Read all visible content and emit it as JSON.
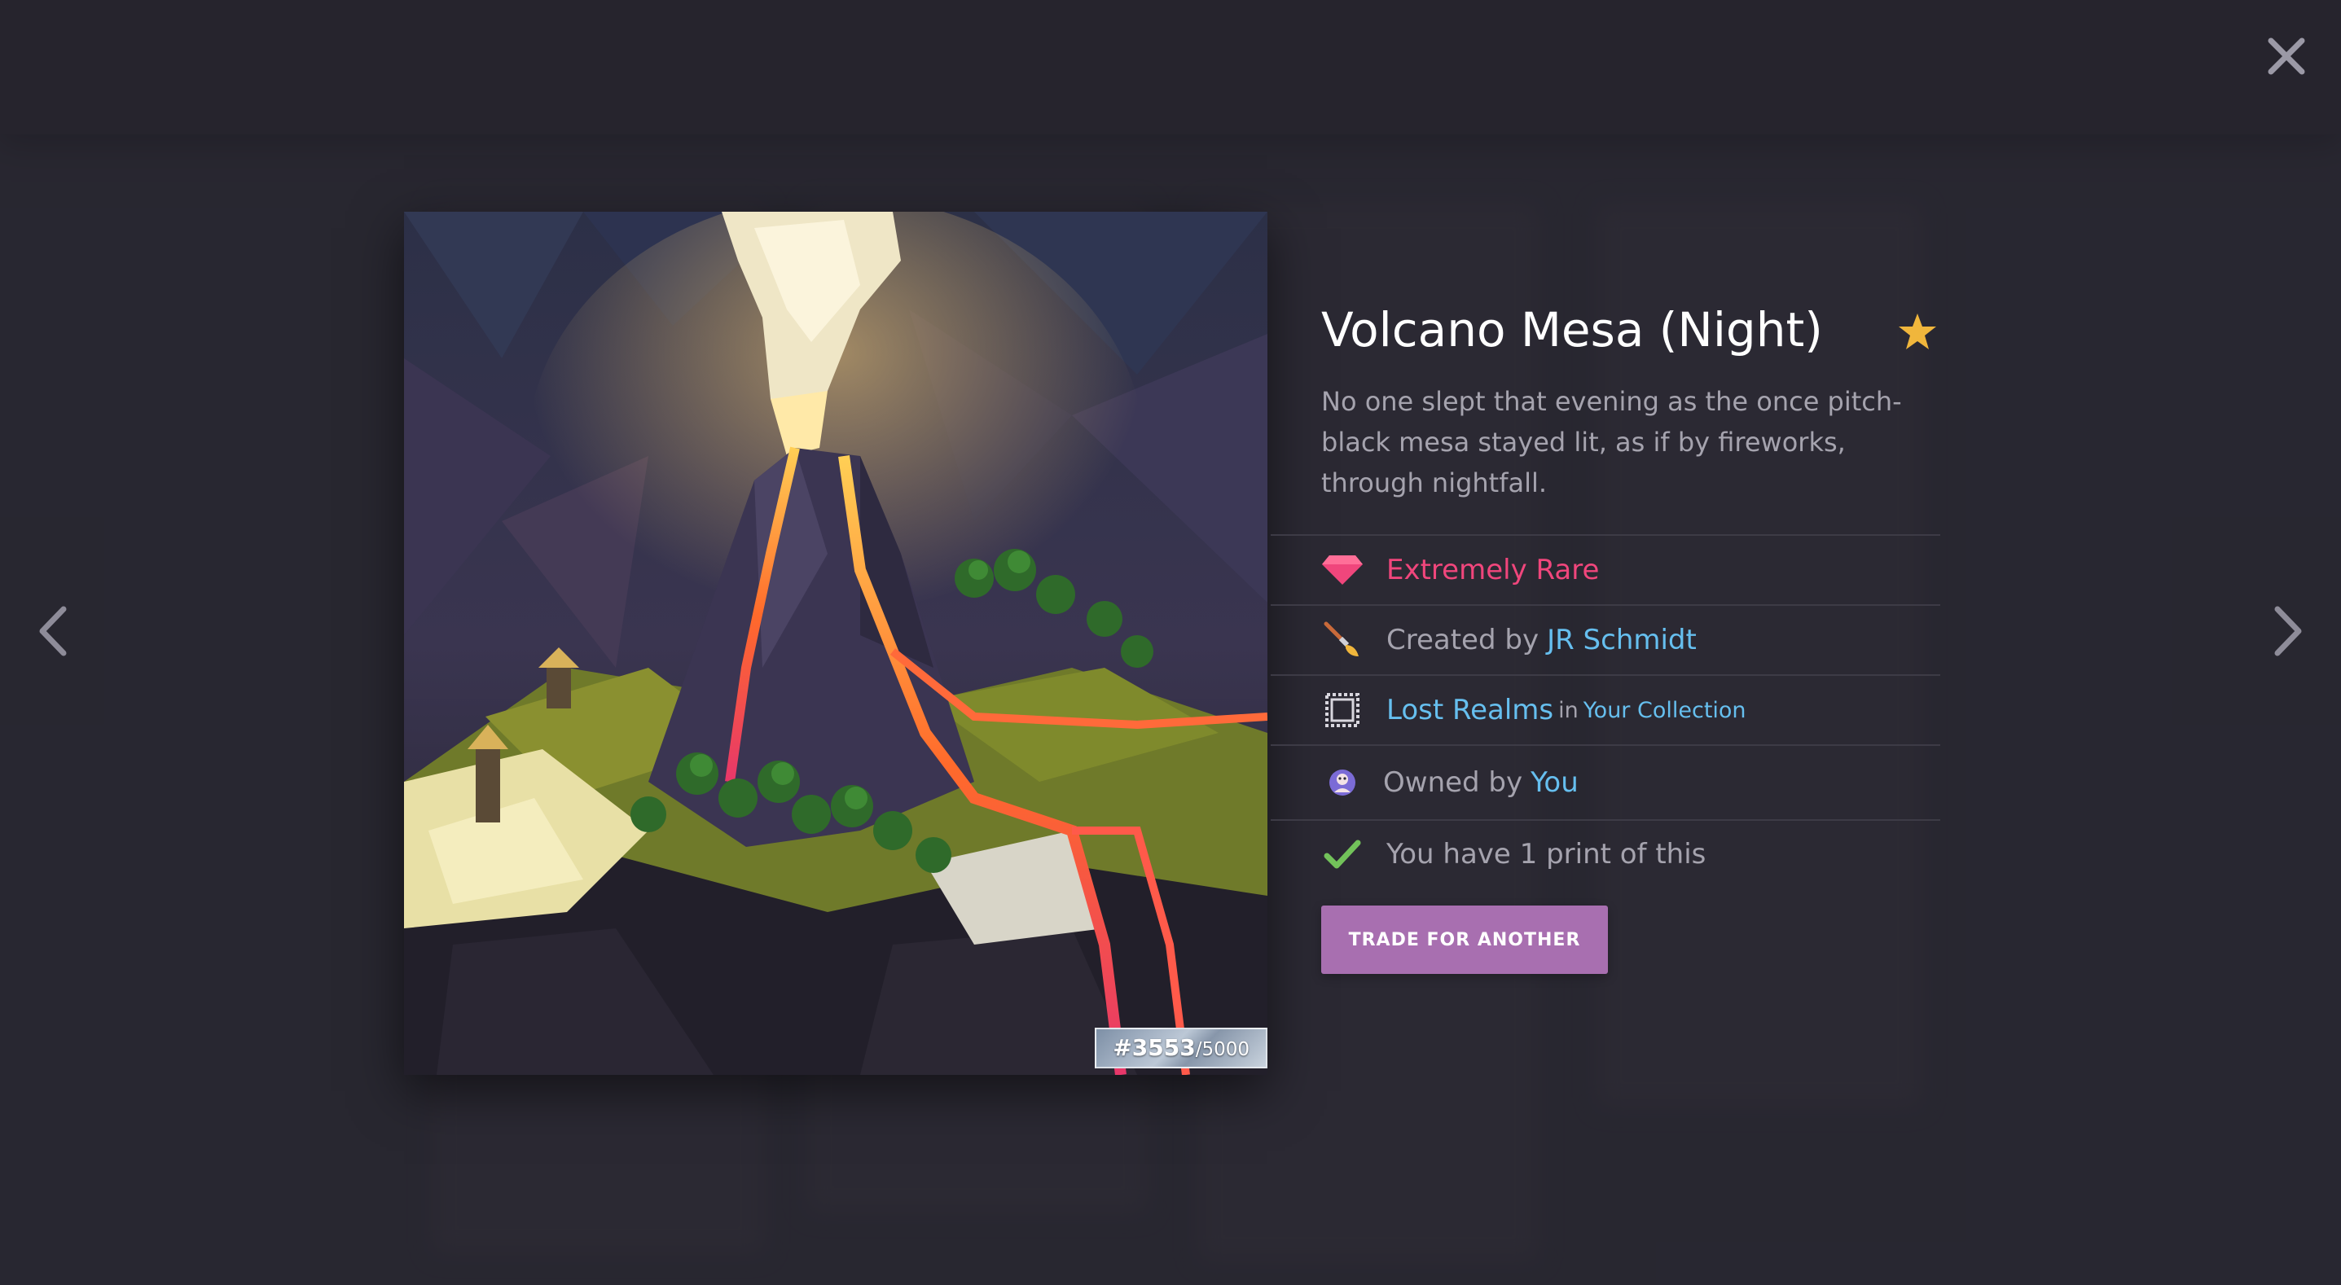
{
  "artwork": {
    "serial_number": "#3553",
    "serial_total": "5000"
  },
  "card": {
    "title": "Volcano Mesa (Night)",
    "description": "No one slept that evening as the once pitch-black mesa stayed lit, as if by fireworks, through nightfall.",
    "rarity": "Extremely Rare",
    "created_by_prefix": "Created by",
    "creator": "JR Schmidt",
    "collection_name": "Lost Realms",
    "collection_in": "in",
    "collection_owner": "Your Collection",
    "owned_by_prefix": "Owned by",
    "owner": "You",
    "prints_text": "You have 1 print of this",
    "trade_button": "TRADE FOR ANOTHER"
  },
  "icons": {
    "close": "close-icon",
    "prev": "chevron-left-icon",
    "next": "chevron-right-icon",
    "favorite": "star-icon",
    "rarity": "gem-icon",
    "creator": "paintbrush-icon",
    "collection": "stamp-frame-icon",
    "owner": "avatar-icon",
    "prints": "checkmark-icon"
  },
  "colors": {
    "background": "#2b2a34",
    "rarity": "#f0467c",
    "link": "#66bfef",
    "star": "#f0b63c",
    "check": "#72c25a",
    "button": "#a86fb0"
  }
}
